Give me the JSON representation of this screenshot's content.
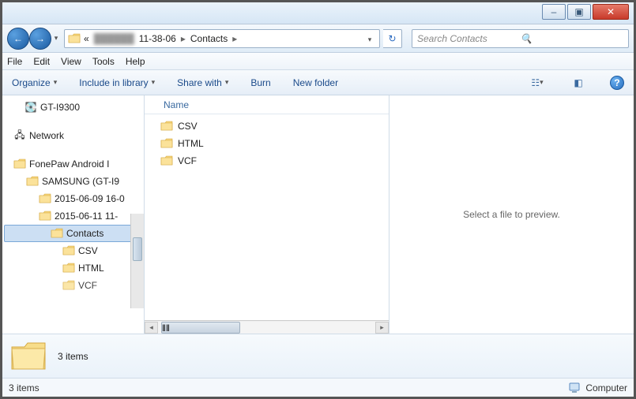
{
  "titlebar": {
    "minimize": "–",
    "maximize": "▣",
    "close": "✕"
  },
  "address": {
    "back_hint": "Back",
    "forward_hint": "Forward",
    "prefix": "«",
    "blurred_segment": "██████",
    "segment_time": "11-38-06",
    "segment_folder": "Contacts",
    "sep": "▸"
  },
  "search": {
    "placeholder": "Search Contacts"
  },
  "menu": {
    "file": "File",
    "edit": "Edit",
    "view": "View",
    "tools": "Tools",
    "help": "Help"
  },
  "toolbar": {
    "organize": "Organize",
    "include": "Include in library",
    "share": "Share with",
    "burn": "Burn",
    "new_folder": "New folder"
  },
  "tree": {
    "drive_item": "GT-I9300",
    "network": "Network",
    "root": "FonePaw Android I",
    "samsung": "SAMSUNG (GT-I9",
    "date1": "2015-06-09 16-0",
    "date2": "2015-06-11 11-",
    "contacts": "Contacts",
    "csv": "CSV",
    "html": "HTML",
    "vcf": "VCF"
  },
  "content": {
    "column_name": "Name",
    "items": [
      "CSV",
      "HTML",
      "VCF"
    ]
  },
  "preview": {
    "hint": "Select a file to preview."
  },
  "details": {
    "summary": "3 items"
  },
  "status": {
    "left": "3 items",
    "computer": "Computer"
  }
}
